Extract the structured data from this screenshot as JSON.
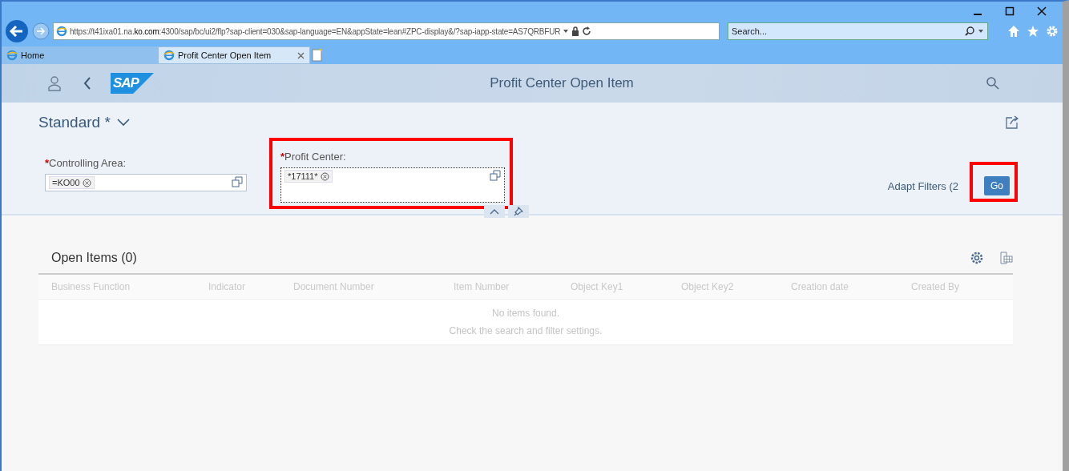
{
  "browser": {
    "url": "https://t41ixa01.na.**ko.com**:4300/sap/bc/ui2/flp?sap-client=030&sap-language=EN&appState=lean#ZPC-display&/?sap-iapp-state=AS7QRBFUR",
    "search_placeholder": "Search...",
    "tabs": [
      {
        "label": "Home",
        "selected": false
      },
      {
        "label": "Profit Center Open Item",
        "selected": true
      }
    ]
  },
  "shell": {
    "logo": "SAP",
    "title": "Profit Center Open Item"
  },
  "filter_bar": {
    "variant": "Standard *",
    "fields": [
      {
        "required_marker": "*",
        "label": "Controlling Area:",
        "token": "=KO00",
        "highlighted": false
      },
      {
        "required_marker": "*",
        "label": "Profit Center:",
        "token": "*17111*",
        "highlighted": true
      }
    ],
    "adapt_filters": "Adapt Filters (2",
    "go_button": {
      "label": "Go",
      "highlighted": true
    }
  },
  "table": {
    "title": "Open Items (0)",
    "columns": [
      "Business Function",
      "Indicator",
      "Document Number",
      "Item Number",
      "Object Key1",
      "Object Key2",
      "Creation date",
      "Created By"
    ],
    "empty_message": [
      "No items found.",
      "Check the search and filter settings."
    ]
  }
}
